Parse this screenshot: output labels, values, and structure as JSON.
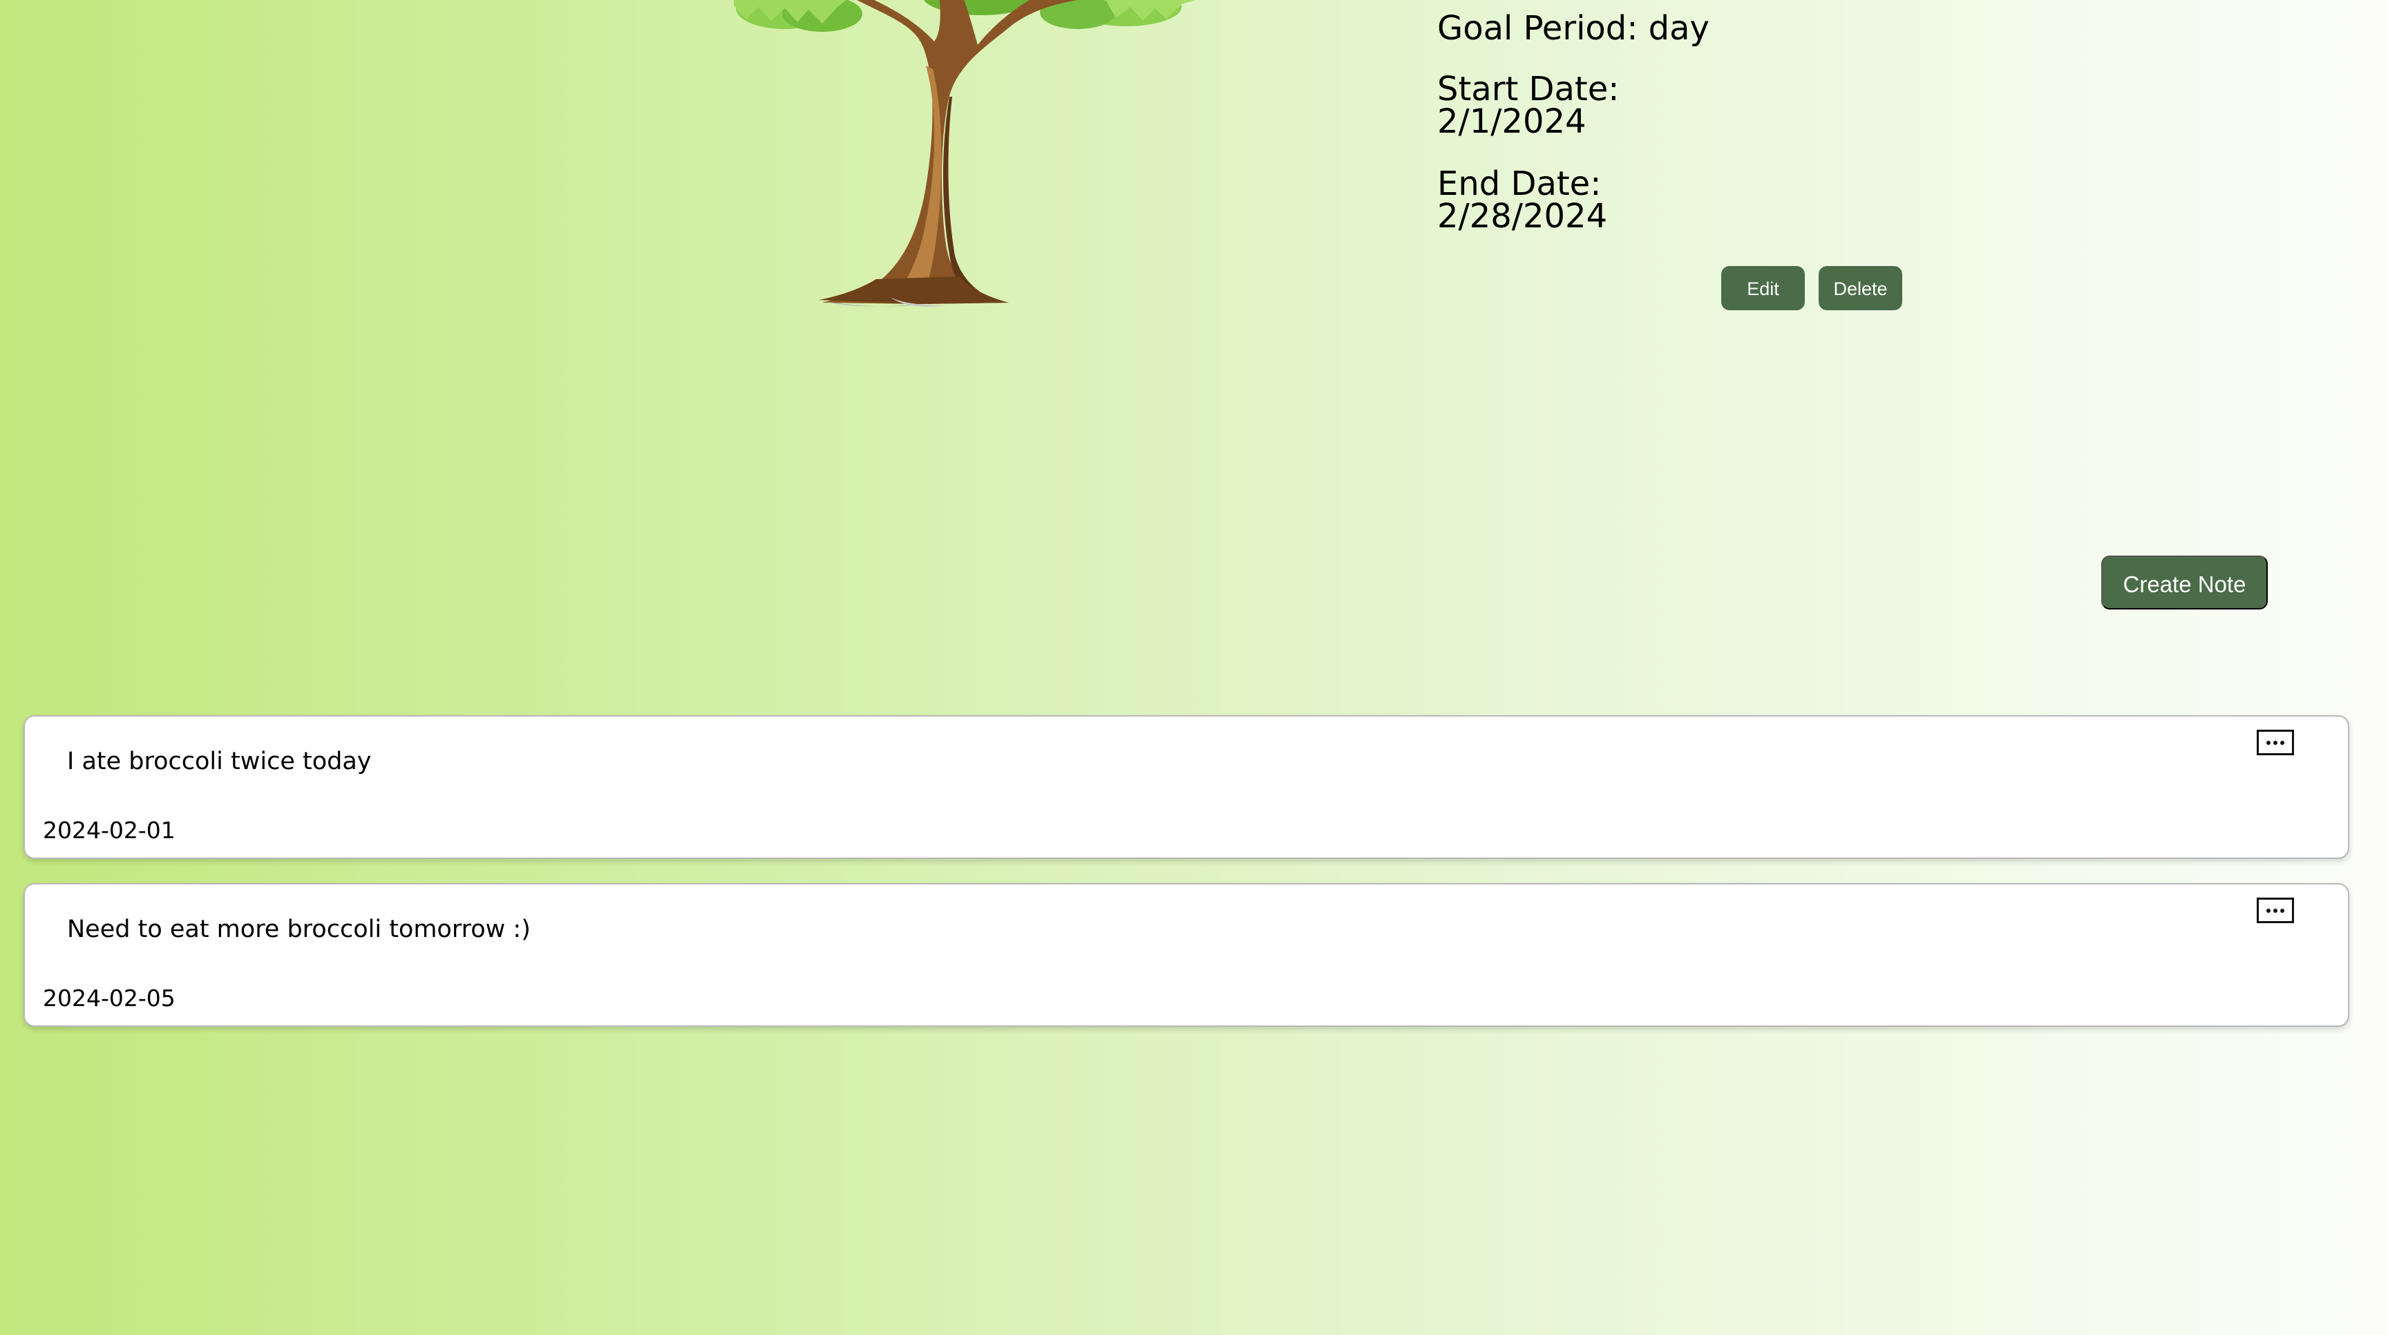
{
  "goal": {
    "period": "Goal Period: day",
    "start_label": "Start Date:",
    "start_value": "2/1/2024",
    "end_label": "End Date:",
    "end_value": "2/28/2024"
  },
  "actions": {
    "edit": "Edit",
    "delete": "Delete",
    "create_note": "Create Note"
  },
  "notes": [
    {
      "text": "I ate broccoli twice today",
      "date": "2024-02-01"
    },
    {
      "text": "Need to eat more broccoli tomorrow :)",
      "date": "2024-02-05"
    }
  ],
  "icons": {
    "tree": "tree-illustration",
    "more": "more-options-icon"
  },
  "colors": {
    "button": "#4b6c48",
    "gradient_start": "#c2e87e",
    "gradient_end": "#fcfdfa"
  }
}
